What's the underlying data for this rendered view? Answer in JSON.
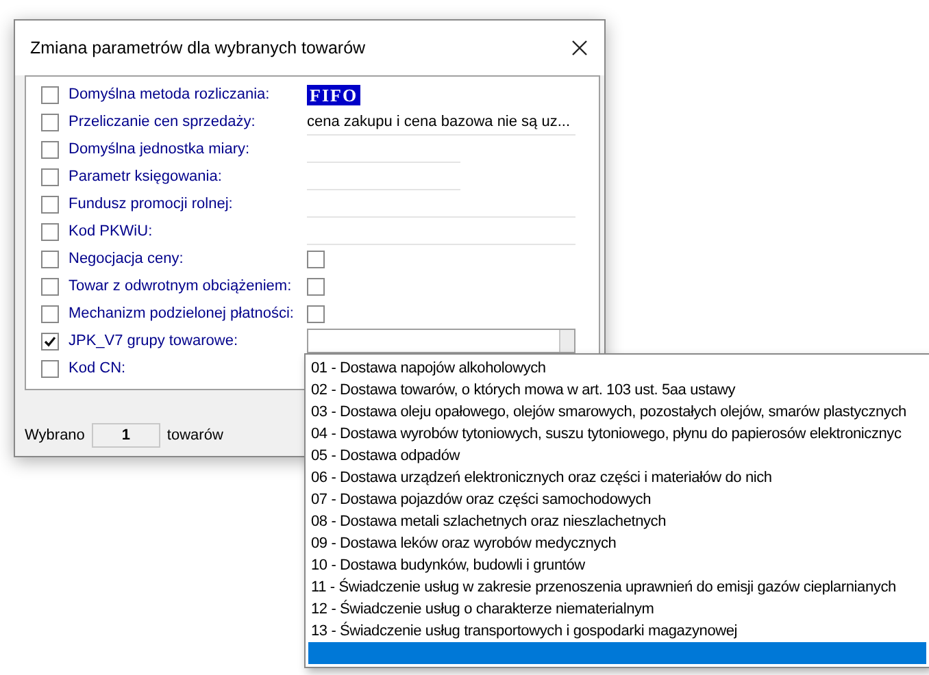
{
  "window": {
    "title": "Zmiana parametrów dla wybranych towarów"
  },
  "fields": [
    {
      "label": "Domyślna metoda rozliczania:",
      "checked": false,
      "kind": "text",
      "value": "FIFO",
      "highlighted": true
    },
    {
      "label": "Przeliczanie cen sprzedaży:",
      "checked": false,
      "kind": "text",
      "value": "cena zakupu i cena bazowa nie są uz...",
      "highlighted": false
    },
    {
      "label": "Domyślna jednostka miary:",
      "checked": false,
      "kind": "short_line"
    },
    {
      "label": "Parametr księgowania:",
      "checked": false,
      "kind": "short_line"
    },
    {
      "label": "Fundusz promocji rolnej:",
      "checked": false,
      "kind": "line"
    },
    {
      "label": "Kod PKWiU:",
      "checked": false,
      "kind": "line"
    },
    {
      "label": "Negocjacja ceny:",
      "checked": false,
      "kind": "checkbox",
      "value_checked": false
    },
    {
      "label": "Towar z odwrotnym obciążeniem:",
      "checked": false,
      "kind": "checkbox",
      "value_checked": false
    },
    {
      "label": "Mechanizm podzielonej płatności:",
      "checked": false,
      "kind": "checkbox",
      "value_checked": false
    },
    {
      "label": "JPK_V7 grupy towarowe:",
      "checked": true,
      "kind": "combo"
    },
    {
      "label": "Kod CN:",
      "checked": false,
      "kind": "none"
    }
  ],
  "footer": {
    "label": "Wybrano",
    "count": "1",
    "unit": "towarów"
  },
  "dropdown": {
    "items": [
      {
        "label": "01 - Dostawa napojów alkoholowych",
        "selected": false
      },
      {
        "label": "02 - Dostawa towarów, o których mowa w art. 103 ust. 5aa ustawy",
        "selected": false
      },
      {
        "label": "03 - Dostawa oleju opałowego, olejów smarowych, pozostałych olejów, smarów plastycznych",
        "selected": false
      },
      {
        "label": "04 - Dostawa wyrobów tytoniowych, suszu tytoniowego, płynu do papierosów elektronicznyc",
        "selected": false
      },
      {
        "label": "05 - Dostawa odpadów",
        "selected": false
      },
      {
        "label": "06 - Dostawa urządzeń elektronicznych oraz części i materiałów do nich",
        "selected": false
      },
      {
        "label": "07 - Dostawa pojazdów oraz części samochodowych",
        "selected": false
      },
      {
        "label": "08 - Dostawa metali szlachetnych oraz nieszlachetnych",
        "selected": false
      },
      {
        "label": "09 - Dostawa leków oraz wyrobów medycznych",
        "selected": false
      },
      {
        "label": "10 - Dostawa budynków, budowli i gruntów",
        "selected": false
      },
      {
        "label": "11 - Świadczenie usług w zakresie przenoszenia uprawnień do emisji gazów cieplarnianych",
        "selected": false
      },
      {
        "label": "12 - Świadczenie usług o charakterze niematerialnym",
        "selected": false
      },
      {
        "label": "13 - Świadczenie usług transportowych i gospodarki magazynowej",
        "selected": false
      }
    ],
    "blank_row_selected": true
  }
}
